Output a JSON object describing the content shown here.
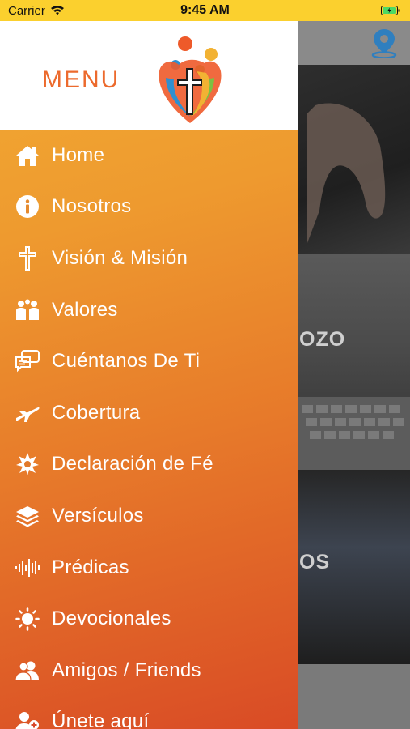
{
  "status_bar": {
    "carrier": "Carrier",
    "time": "9:45 AM"
  },
  "menu": {
    "title": "MENU",
    "items": [
      {
        "label": "Home",
        "icon": "home-icon"
      },
      {
        "label": "Nosotros",
        "icon": "info-icon"
      },
      {
        "label": "Visión & Misión",
        "icon": "cross-icon"
      },
      {
        "label": "Valores",
        "icon": "hands-icon"
      },
      {
        "label": "Cuéntanos De Ti",
        "icon": "chat-icon"
      },
      {
        "label": "Cobertura",
        "icon": "airplane-icon"
      },
      {
        "label": "Declaración de Fé",
        "icon": "starburst-icon"
      },
      {
        "label": "Versículos",
        "icon": "layers-icon"
      },
      {
        "label": "Prédicas",
        "icon": "audio-wave-icon"
      },
      {
        "label": "Devocionales",
        "icon": "sun-icon"
      },
      {
        "label": "Amigos / Friends",
        "icon": "friends-icon"
      },
      {
        "label": "Únete aquí",
        "icon": "join-icon"
      }
    ]
  },
  "background": {
    "card2_text": "OZO",
    "card3_text": "OS"
  },
  "colors": {
    "status_bar": "#fbd02e",
    "menu_title": "#ec6a2d",
    "gradient_top": "#f2ac33",
    "gradient_bottom": "#d94b25",
    "pin": "#2f7fbf"
  }
}
